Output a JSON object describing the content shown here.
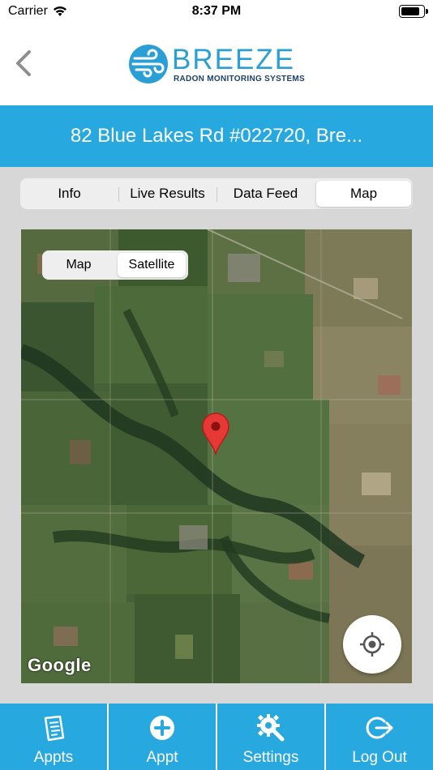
{
  "status_bar": {
    "carrier": "Carrier",
    "time": "8:37 PM"
  },
  "header": {
    "logo_text": "BREEZE",
    "logo_subtext": "RADON MONITORING SYSTEMS"
  },
  "title": "82 Blue Lakes Rd #022720, Bre...",
  "tabs": [
    {
      "label": "Info"
    },
    {
      "label": "Live Results"
    },
    {
      "label": "Data Feed"
    },
    {
      "label": "Map",
      "selected": true
    }
  ],
  "map": {
    "type_toggle": [
      {
        "label": "Map"
      },
      {
        "label": "Satellite",
        "selected": true
      }
    ],
    "attribution": "Google",
    "locate_button_icon": "crosshair-icon",
    "marker_icon": "map-pin-icon"
  },
  "bottom_nav": [
    {
      "label": "Appts",
      "icon": "clipboard-icon"
    },
    {
      "label": "Appt",
      "icon": "plus-circle-icon"
    },
    {
      "label": "Settings",
      "icon": "gear-wrench-icon"
    },
    {
      "label": "Log Out",
      "icon": "logout-icon"
    }
  ],
  "colors": {
    "accent": "#27a8de",
    "logo_blue": "#2a9fd6",
    "logo_navy": "#1d3f6e",
    "marker_red": "#e53935"
  }
}
